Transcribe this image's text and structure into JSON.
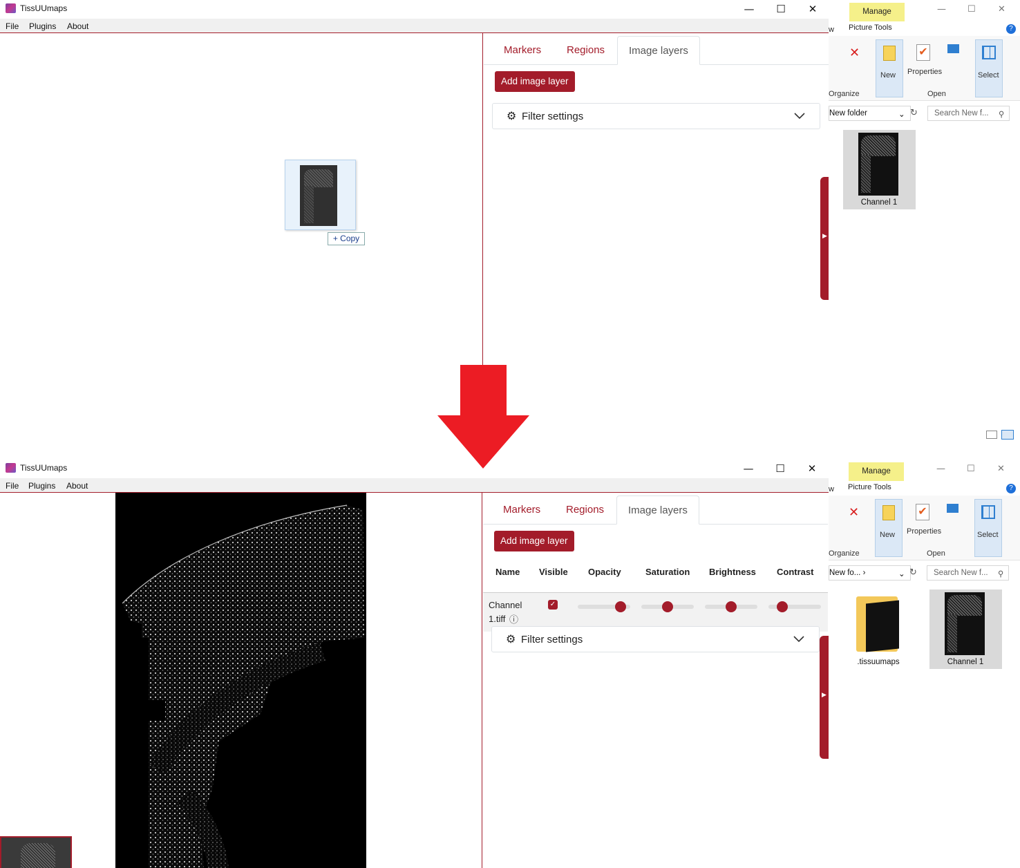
{
  "app": {
    "title": "TissUUmaps",
    "window_controls": [
      "—",
      "☐",
      "✕"
    ],
    "menu": [
      "File",
      "Plugins",
      "About"
    ]
  },
  "tabs": [
    "Markers",
    "Regions",
    "Image layers"
  ],
  "add_layer_label": "Add image layer",
  "filter_label": "Filter settings",
  "drag_copy_label": "+ Copy",
  "layer_table": {
    "headers": [
      "Name",
      "Visible",
      "Opacity",
      "Saturation",
      "Brightness",
      "Contrast"
    ],
    "row": {
      "name_line1": "Channel",
      "name_line2": "1.tiff",
      "info_icon": "ⓘ",
      "visible": true,
      "opacity": 0.9,
      "saturation": 0.5,
      "brightness": 0.5,
      "contrast": 0.2
    }
  },
  "explorer": {
    "manage_label": "Manage",
    "picture_tools_label": "Picture Tools",
    "view_fragment": "w",
    "ribbon": {
      "new": "New",
      "properties": "Properties",
      "select": "Select",
      "organize": "Organize",
      "open": "Open"
    },
    "top": {
      "address": "New folder",
      "search_placeholder": "Search New f...",
      "files": [
        "Channel 1"
      ]
    },
    "bottom": {
      "address": "New fo...  ›",
      "search_placeholder": "Search New f...",
      "files": [
        ".tissuumaps",
        "Channel 1"
      ]
    }
  },
  "colors": {
    "accent": "#a31c2a",
    "arrow": "#ec1c24",
    "manage_bg": "#f5f08a"
  },
  "icons": [
    "app-icon",
    "gear-icon",
    "chevron-down-icon",
    "down-arrow-icon",
    "info-icon",
    "search-icon",
    "refresh-icon"
  ]
}
